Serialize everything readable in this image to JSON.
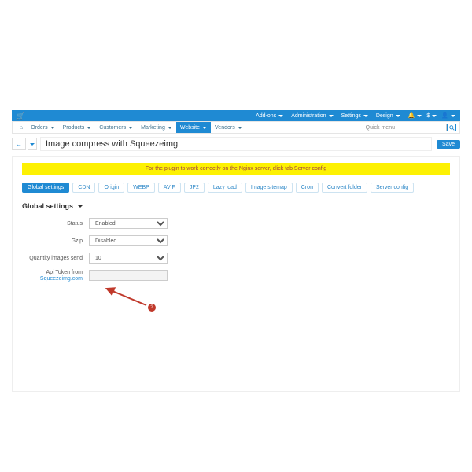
{
  "topbar": {
    "addons": "Add-ons",
    "administration": "Administration",
    "settings": "Settings",
    "design": "Design"
  },
  "nav": {
    "orders": "Orders",
    "products": "Products",
    "customers": "Customers",
    "marketing": "Marketing",
    "website": "Website",
    "vendors": "Vendors",
    "quickmenu": "Quick menu",
    "search_placeholder": ""
  },
  "header": {
    "title": "Image compress with Squeezeimg",
    "save": "Save"
  },
  "alert": {
    "text": "For the plugin to work correctly on the Nginx server, click tab Server config"
  },
  "tabs": [
    "Global settings",
    "CDN",
    "Origin",
    "WEBP",
    "AVIF",
    "JP2",
    "Lazy load",
    "Image sitemap",
    "Cron",
    "Convert folder",
    "Server config"
  ],
  "section": {
    "title": "Global settings"
  },
  "form": {
    "status_label": "Status",
    "status_value": "Enabled",
    "gzip_label": "Gzip",
    "gzip_value": "Disabled",
    "qty_label": "Quantity images send",
    "qty_value": "10",
    "api_label_1": "Api Token from",
    "api_label_link": "Squeezeimg.com",
    "api_value": ""
  },
  "annotation": {
    "num": "?"
  }
}
